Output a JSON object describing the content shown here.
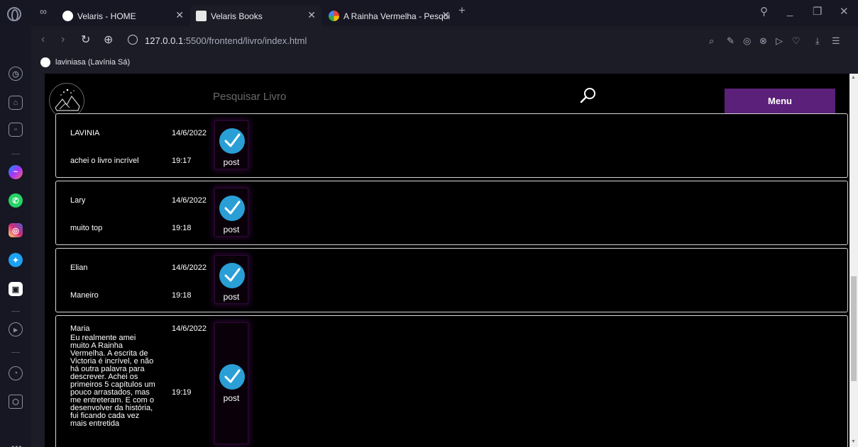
{
  "tabs": [
    {
      "title": "Velaris - HOME"
    },
    {
      "title": "Velaris Books"
    },
    {
      "title": "A Rainha Vermelha - Pesqui"
    }
  ],
  "address": {
    "host": "127.0.0.1",
    "path": ":5500/frontend/livro/index.html"
  },
  "bookmarks": [
    {
      "label": "laviniasa (Lavínia Sá)"
    }
  ],
  "page": {
    "search_placeholder": "Pesquisar Livro",
    "menu_label": "Menu",
    "post_label": "post",
    "comments": [
      {
        "name": "LAVINIA",
        "date": "14/6/2022",
        "text": "achei o livro incrível",
        "time": "19:17"
      },
      {
        "name": "Lary",
        "date": "14/6/2022",
        "text": "muito top",
        "time": "19:18"
      },
      {
        "name": "Elian",
        "date": "14/6/2022",
        "text": "Maneiro",
        "time": "19:18"
      },
      {
        "name": "Maria",
        "date": "14/6/2022",
        "text_lines": [
          "Eu realmente amei",
          "muito A Rainha",
          "Vermelha. A escrita de",
          "Victoria é incrível, e não",
          "há outra palavra para",
          "descrever. Achei os",
          "primeiros 5 capítulos um",
          "pouco arrastados, mas",
          "me entreteram. E com o",
          "desenvolver da história,",
          "fui ficando cada vez",
          "mais entretida"
        ],
        "time": "19:19"
      }
    ]
  },
  "colors": {
    "menu_button": "#5b2079",
    "check": "#2a9fd6",
    "background": "#000000"
  }
}
